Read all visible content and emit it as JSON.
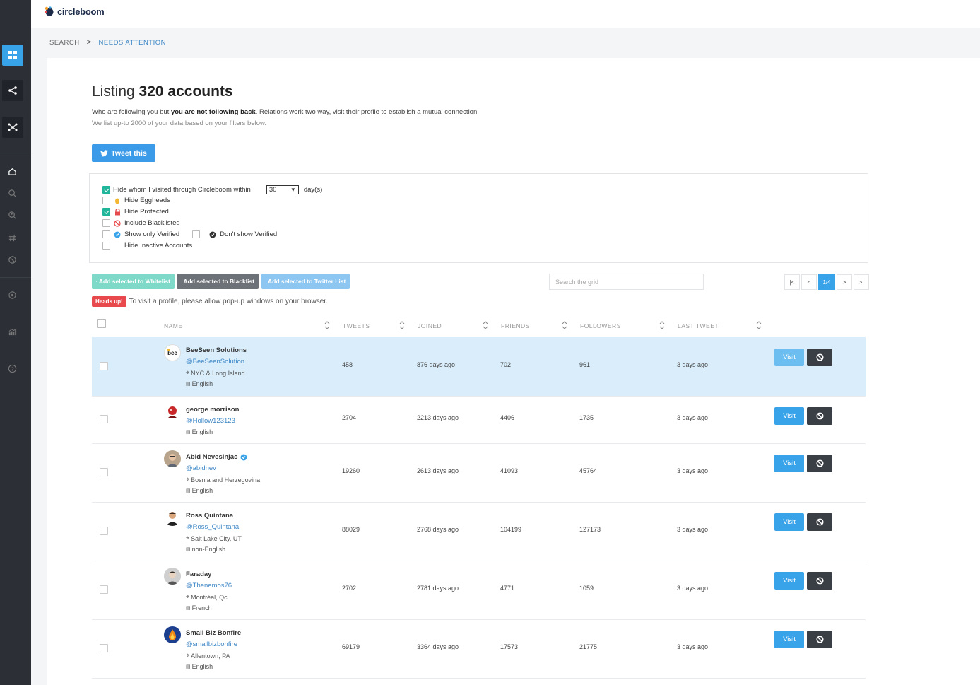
{
  "app": {
    "logo_text": "circleboom"
  },
  "breadcrumb": {
    "first": "SEARCH",
    "separator": ">",
    "current": "NEEDS ATTENTION"
  },
  "header": {
    "title_prefix": "Listing",
    "title_bold": "320 accounts",
    "desc_a": "Who are following you but ",
    "desc_b": "you are not following back",
    "desc_c": ". Relations work two way, visit their profile to establish a mutual connection.",
    "desc2": "We list up-to 2000 of your data based on your filters below.",
    "tweet_label": "Tweet this"
  },
  "filters": {
    "visited_label": "Hide whom I visited through Circleboom within",
    "visited_checked": true,
    "days_value": "30",
    "days_suffix": "day(s)",
    "eggheads_label": "Hide Eggheads",
    "protected_label": "Hide Protected",
    "protected_checked": true,
    "blacklisted_label": "Include Blacklisted",
    "verified_only_label": "Show only Verified",
    "dont_verified_label": "Don't show Verified",
    "inactive_label": "Hide Inactive Accounts"
  },
  "actions": {
    "whitelist": "Add selected to Whitelist",
    "blacklist": "Add selected to Blacklist",
    "twitter_list": "Add selected to Twitter List",
    "search_placeholder": "Search the grid"
  },
  "pager": {
    "first": "|<",
    "prev": "<",
    "current": "1/4",
    "next": ">",
    "last": ">|"
  },
  "headsup": {
    "badge": "Heads up!",
    "text": "To visit a profile, please allow pop-up windows on your browser."
  },
  "columns": {
    "name": "NAME",
    "tweets": "TWEETS",
    "joined": "JOINED",
    "friends": "FRIENDS",
    "followers": "FOLLOWERS",
    "last_tweet": "LAST TWEET"
  },
  "buttons": {
    "visit": "Visit"
  },
  "rows": [
    {
      "name": "BeeSeen Solutions",
      "handle": "@BeeSeenSolution",
      "location": "NYC & Long Island",
      "language": "English",
      "tweets": "458",
      "joined": "876 days ago",
      "friends": "702",
      "followers": "961",
      "last_tweet": "3 days ago"
    },
    {
      "name": "george morrison",
      "handle": "@Hollow123123",
      "location": "",
      "language": "English",
      "tweets": "2704",
      "joined": "2213 days ago",
      "friends": "4406",
      "followers": "1735",
      "last_tweet": "3 days ago"
    },
    {
      "name": "Abid Nevesinjac",
      "handle": "@abidnev",
      "location": "Bosnia and Herzegovina",
      "language": "English",
      "tweets": "19260",
      "joined": "2613 days ago",
      "friends": "41093",
      "followers": "45764",
      "last_tweet": "3 days ago"
    },
    {
      "name": "Ross Quintana",
      "handle": "@Ross_Quintana",
      "location": "Salt Lake City, UT",
      "language": "non-English",
      "tweets": "88029",
      "joined": "2768 days ago",
      "friends": "104199",
      "followers": "127173",
      "last_tweet": "3 days ago"
    },
    {
      "name": "Faraday",
      "handle": "@Thenemos76",
      "location": "Montréal, Qc",
      "language": "French",
      "tweets": "2702",
      "joined": "2781 days ago",
      "friends": "4771",
      "followers": "1059",
      "last_tweet": "3 days ago"
    },
    {
      "name": "Small Biz Bonfire",
      "handle": "@smallbizbonfire",
      "location": "Allentown, PA",
      "language": "English",
      "tweets": "69179",
      "joined": "3364 days ago",
      "friends": "17573",
      "followers": "21775",
      "last_tweet": "3 days ago"
    }
  ]
}
